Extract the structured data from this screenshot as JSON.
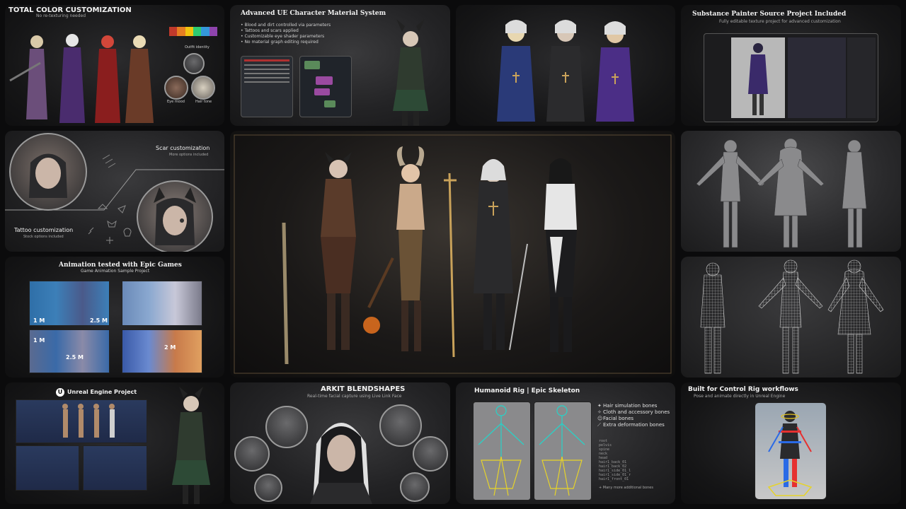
{
  "tiles": {
    "color": {
      "title": "TOTAL COLOR CUSTOMIZATION",
      "subtitle": "No re-texturing needed",
      "outfit_label": "Outfit identity",
      "eye_label": "Eye mood",
      "hair_label": "Hair tone",
      "swatch_colors": [
        "#c0392b",
        "#e67e22",
        "#f1c40f",
        "#2ecc71",
        "#3498db",
        "#8e44ad"
      ]
    },
    "material": {
      "title": "Advanced UE Character Material System",
      "bullets": [
        "• Blood and dirt controlled via parameters",
        "• Tattoos and scars applied",
        "• Customizable eye shader parameters",
        "• No material graph editing required"
      ]
    },
    "substance": {
      "title": "Substance Painter Source Project Included",
      "subtitle": "Fully editable texture project for advanced customization"
    },
    "scar": {
      "scar_label": "Scar customization",
      "scar_sub": "More options included",
      "tattoo_label": "Tattoo customization",
      "tattoo_sub": "Stock options included"
    },
    "animation": {
      "title": "Animation tested with Epic Games",
      "subtitle": "Game Animation Sample Project",
      "clip_labels": [
        "1 M",
        "2.5 M",
        "1 M",
        "2.5 M",
        "2 M"
      ]
    },
    "unreal": {
      "title": "Unreal Engine Project",
      "logo": "U"
    },
    "arkit": {
      "title": "ARKIT BLENDSHAPES",
      "subtitle": "Real-time facial capture using Live Link Face"
    },
    "rig": {
      "title": "Humanoid Rig | Epic Skeleton",
      "bones": [
        {
          "icon": "hair-icon",
          "label": "Hair simulation bones"
        },
        {
          "icon": "cloth-icon",
          "label": "Cloth and accessory bones"
        },
        {
          "icon": "face-icon",
          "label": "Facial bones"
        },
        {
          "icon": "bone-icon",
          "label": "Extra deformation bones"
        }
      ],
      "tree": [
        "root",
        " pelvis",
        "  spine",
        "   neck",
        "    head",
        "     hair1_back_01",
        "     hair1_back_02",
        "     hair1_side_01_l",
        "     hair1_side_01_r",
        "     hair1_front_01"
      ],
      "footnote": "+ Many more additional bones"
    },
    "control": {
      "title": "Built for Control Rig workflows",
      "subtitle": "Pose and animate directly in Unreal Engine"
    }
  },
  "colors": {
    "accent_gold": "#c9a25a",
    "ue_panel": "#1f2a48",
    "rig_cyan": "#27d3c8",
    "rig_yellow": "#e6d32a"
  }
}
